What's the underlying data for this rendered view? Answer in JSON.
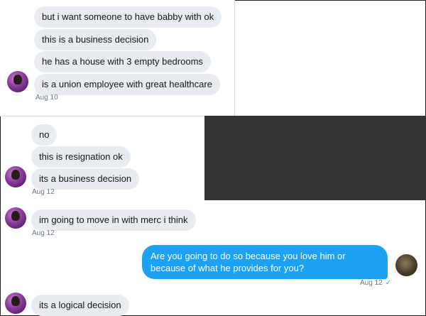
{
  "messages_top": [
    "but i want someone to have babby with ok",
    "this is a business decision",
    "he has a house with 3 empty bedrooms",
    "is a union employee with great healthcare"
  ],
  "ts_top": "Aug 10",
  "messages_mid": [
    "no",
    "this is resignation ok",
    "its a business decision"
  ],
  "ts_mid": "Aug 12",
  "message_single": "im going to move in with merc i think",
  "ts_single": "Aug 12",
  "outgoing": {
    "text": "Are you going to do so because you love him or because of what he provides for you?",
    "timestamp": "Aug 12",
    "status_icon": "✓"
  },
  "message_last": "its a logical decision",
  "colors": {
    "incoming_bubble": "#e6ecf0",
    "outgoing_bubble": "#1da1f2",
    "timestamp": "#657786"
  }
}
